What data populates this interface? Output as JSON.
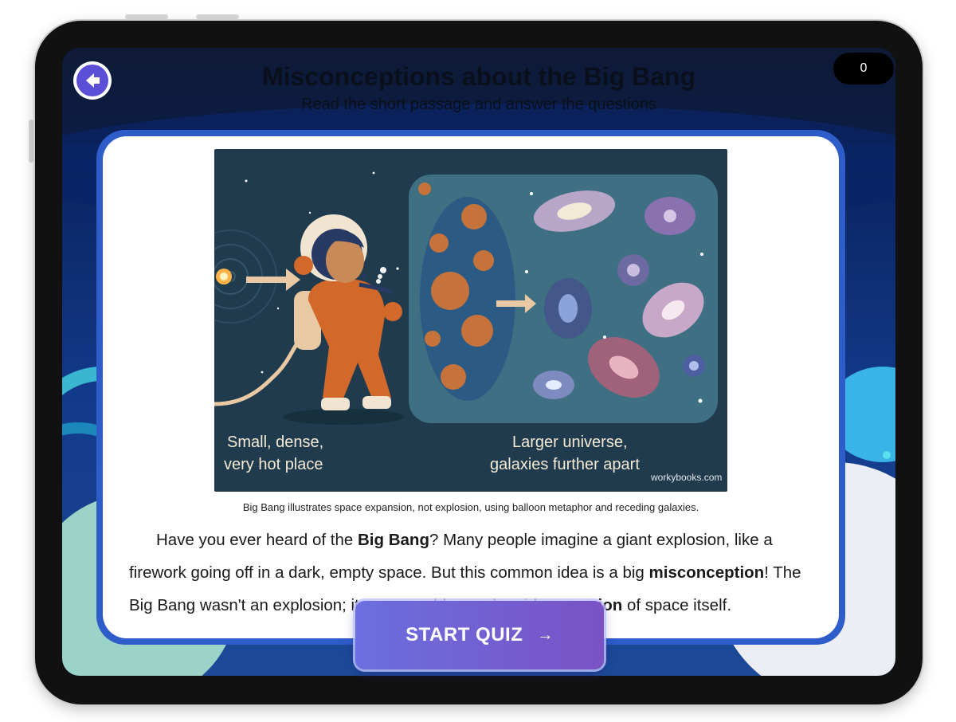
{
  "header": {
    "title": "Misconceptions about the Big Bang",
    "subtitle": "Read the short passage and answer the questions",
    "score": "0"
  },
  "figure": {
    "label_left_line1": "Small, dense,",
    "label_left_line2": "very hot place",
    "label_right_line1": "Larger universe,",
    "label_right_line2": "galaxies further apart",
    "watermark": "workybooks.com",
    "caption": "Big Bang illustrates space expansion, not explosion, using balloon metaphor and receding galaxies."
  },
  "passage": {
    "t1": "Have you ever heard of the ",
    "b1": "Big Bang",
    "t2": "? Many people imagine a giant explosion, like a firework going off in a dark, empty space. But this common idea is a big ",
    "b2": "misconception",
    "t3": "! The Big Bang wasn't an explosion; it was a sudden and rapid ",
    "b3": "expansion",
    "t4": " of space itself."
  },
  "actions": {
    "start_quiz_label": "START QUIZ",
    "start_quiz_arrow": "→"
  },
  "icons": {
    "back": "arrow-left-icon",
    "start_quiz": "arrow-right-icon"
  },
  "colors": {
    "accent": "#5a4fd6",
    "card_border": "#2e5cc8",
    "button_start": "#6b6fe0",
    "button_end": "#7a52c4"
  }
}
